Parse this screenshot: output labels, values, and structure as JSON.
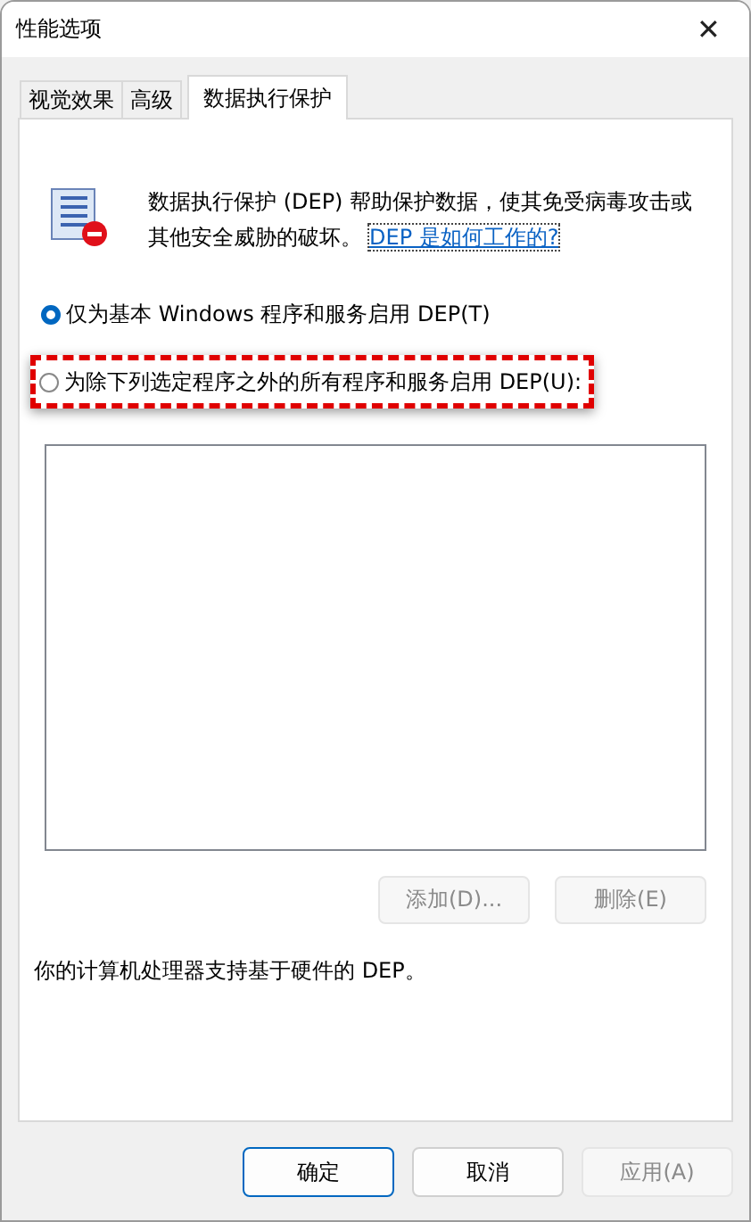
{
  "window": {
    "title": "性能选项",
    "close": "✕"
  },
  "tabs": [
    {
      "label": "视觉效果",
      "selected": false
    },
    {
      "label": "高级",
      "selected": false
    },
    {
      "label": "数据执行保护",
      "selected": true
    }
  ],
  "description": "数据执行保护 (DEP) 帮助保护数据，使其免受病毒攻击或其他安全威胁的破坏。",
  "help_link": "DEP 是如何工作的?",
  "options": [
    {
      "label": "仅为基本 Windows 程序和服务启用 DEP(T)",
      "selected": true,
      "highlighted": false
    },
    {
      "label": "为除下列选定程序之外的所有程序和服务启用 DEP(U):",
      "selected": false,
      "highlighted": true
    }
  ],
  "list_buttons": [
    {
      "label": "添加(D)...",
      "disabled": true
    },
    {
      "label": "删除(E)",
      "disabled": true
    }
  ],
  "note": "你的计算机处理器支持基于硬件的 DEP。",
  "buttons": [
    {
      "label": "确定",
      "disabled": false,
      "default": true
    },
    {
      "label": "取消",
      "disabled": false,
      "default": false
    },
    {
      "label": "应用(A)",
      "disabled": true,
      "default": false
    }
  ]
}
